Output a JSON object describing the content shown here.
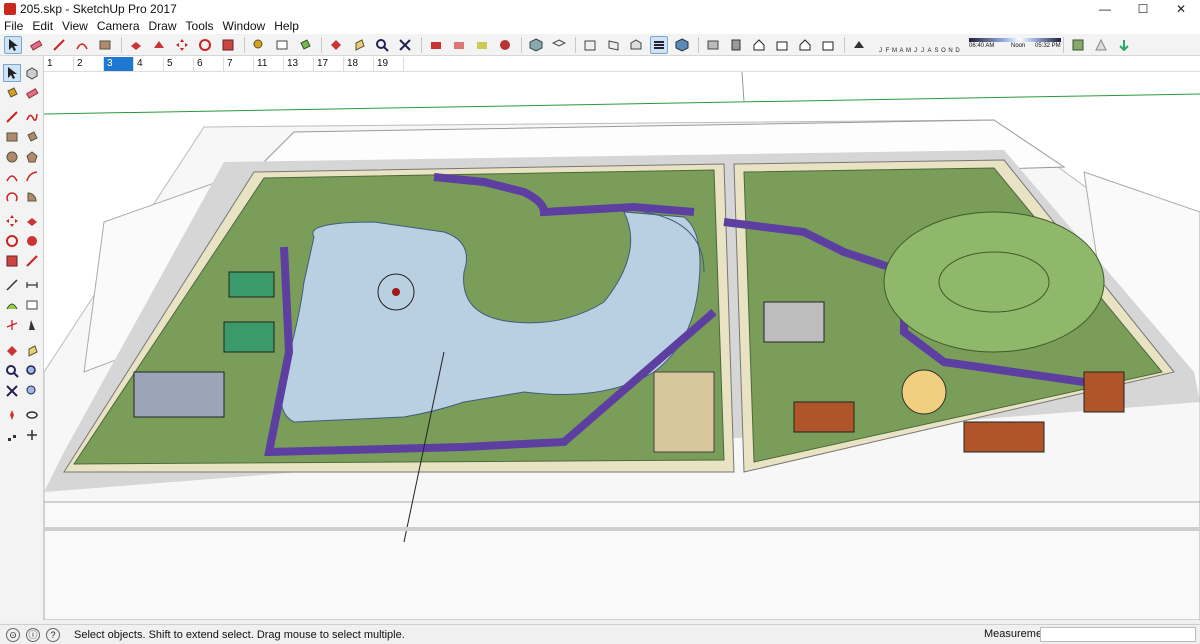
{
  "window": {
    "title": "205.skp - SketchUp Pro 2017",
    "minimize_glyph": "—",
    "maximize_glyph": "☐",
    "close_glyph": "✕"
  },
  "menu": {
    "items": [
      "File",
      "Edit",
      "View",
      "Camera",
      "Draw",
      "Tools",
      "Window",
      "Help"
    ]
  },
  "toolbar": {
    "icons": [
      "select-icon",
      "eraser-icon",
      "pencil-icon",
      "arc-icon",
      "rectangle-icon",
      "push-pull-icon",
      "follow-me-icon",
      "move-icon",
      "rotate-icon",
      "scale-icon",
      "offset-icon",
      "tape-measure-icon",
      "text-icon",
      "paint-bucket-icon",
      "orbit-icon",
      "pan-icon",
      "zoom-icon",
      "zoom-extents-icon",
      "previous-scene-icon",
      "camera-icon",
      "walk-icon",
      "section-icon",
      "iso-view-icon",
      "top-view-icon",
      "front-view-icon",
      "right-view-icon",
      "back-view-icon",
      "left-view-icon",
      "xray-icon",
      "wireframe-icon",
      "hidden-line-icon",
      "shaded-icon",
      "shaded-texture-icon",
      "monochrome-icon",
      "components-icon",
      "materials-icon",
      "warehouse-icon",
      "building-icon",
      "house-icon",
      "shadow-toggle-icon"
    ],
    "months": [
      "J",
      "F",
      "M",
      "A",
      "M",
      "J",
      "J",
      "A",
      "S",
      "O",
      "N",
      "D"
    ],
    "time_start": "06:40 AM",
    "time_mid": "Noon",
    "time_end": "05:32 PM"
  },
  "scene_tabs": {
    "items": [
      "1",
      "2",
      "3",
      "4",
      "5",
      "6",
      "7",
      "11",
      "13",
      "17",
      "18",
      "19"
    ],
    "active_index": 2
  },
  "status": {
    "message": "Select objects. Shift to extend select. Drag mouse to select multiple.",
    "measurements_label": "Measurements"
  },
  "colors": {
    "selection": "#1e78d0",
    "water": "#b9cfe2",
    "grass": "#7a9e5a",
    "path": "#5c3fa0",
    "road": "#d9d9d9"
  }
}
